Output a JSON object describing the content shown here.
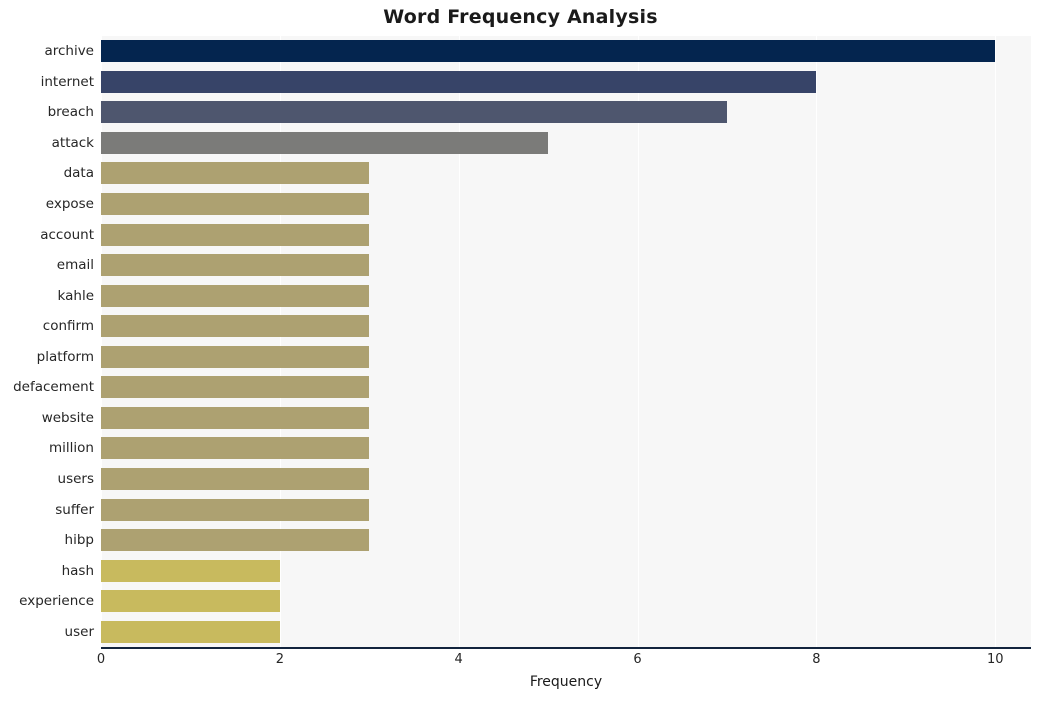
{
  "chart_data": {
    "type": "bar",
    "orientation": "horizontal",
    "title": "Word Frequency Analysis",
    "xlabel": "Frequency",
    "ylabel": "",
    "categories": [
      "archive",
      "internet",
      "breach",
      "attack",
      "data",
      "expose",
      "account",
      "email",
      "kahle",
      "confirm",
      "platform",
      "defacement",
      "website",
      "million",
      "users",
      "suffer",
      "hibp",
      "hash",
      "experience",
      "user"
    ],
    "values": [
      10,
      8,
      7,
      5,
      3,
      3,
      3,
      3,
      3,
      3,
      3,
      3,
      3,
      3,
      3,
      3,
      3,
      2,
      2,
      2
    ],
    "bar_colors": [
      "#04254f",
      "#374468",
      "#4e566e",
      "#7b7b79",
      "#ada171",
      "#ada171",
      "#ada171",
      "#ada171",
      "#ada171",
      "#ada171",
      "#ada171",
      "#ada171",
      "#ada171",
      "#ada171",
      "#ada171",
      "#ada171",
      "#ada171",
      "#c8ba5e",
      "#c8ba5e",
      "#c8ba5e"
    ],
    "xlim": [
      0,
      10.4
    ],
    "x_ticks": [
      0,
      2,
      4,
      6,
      8,
      10
    ],
    "x_tick_labels": [
      "0",
      "2",
      "4",
      "6",
      "8",
      "10"
    ],
    "grid": true,
    "grid_axis": "x",
    "legend": null,
    "plot_background": "#f7f7f7",
    "figure_background": "#ffffff",
    "axis_line_color": "#12243d"
  }
}
